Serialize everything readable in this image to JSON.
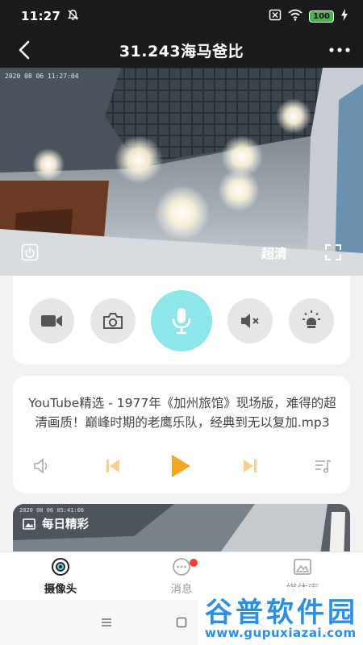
{
  "status_bar": {
    "time": "11:27",
    "battery": "100"
  },
  "header": {
    "title": "31.243海马爸比"
  },
  "video": {
    "timestamp": "2020 08 06 11:27:04",
    "quality": "超清"
  },
  "controls": {
    "items": [
      "video-record",
      "snapshot",
      "microphone",
      "mute",
      "night-light"
    ]
  },
  "music": {
    "title": "YouTube精选 - 1977年《加州旅馆》现场版，难得的超清画质！巅峰时期的老鹰乐队，经典到无以复加.mp3"
  },
  "daily": {
    "timestamp": "2020 08 06 05:41:06",
    "label": "每日精彩"
  },
  "bottom_nav": {
    "items": [
      {
        "label": "摄像头",
        "active": true
      },
      {
        "label": "消息",
        "active": false
      },
      {
        "label": "媒体库",
        "active": false
      }
    ]
  },
  "watermark": {
    "main": "谷普软件园",
    "url": "www.gupuxiazai.com"
  },
  "colors": {
    "accent": "#f5a623",
    "mic": "#8ee6e8",
    "badge": "#f44336"
  }
}
